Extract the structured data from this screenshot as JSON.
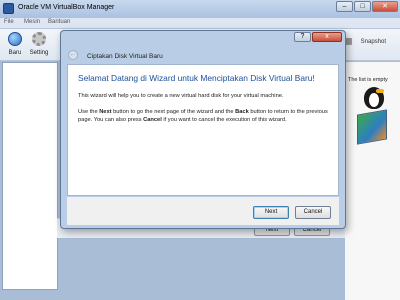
{
  "manager": {
    "title": "Oracle VM VirtualBox Manager",
    "menu": [
      "File",
      "Mesin",
      "Bantuan"
    ],
    "toolbar": {
      "new_label": "Baru",
      "settings_label": "Setting",
      "snapshot_label": "Snapshot"
    },
    "empty_list_text": "The list is empty",
    "behind_buttons": {
      "next": "Next",
      "cancel": "Cancel"
    }
  },
  "dialog": {
    "title": "Ciptakan Disk Virtual Baru",
    "heading": "Selamat Datang di Wizard untuk Menciptakan Disk Virtual Baru!",
    "paragraph1": "This wizard will help you to create a new virtual hard disk for your virtual machine.",
    "paragraph2_parts": {
      "a": "Use the ",
      "next": "Next",
      "b": " button to go the next page of the wizard and the ",
      "back": "Back",
      "c": " button to return to the previous page. You can also press ",
      "cancel": "Cancel",
      "d": " if you want to cancel the execution of this wizard."
    },
    "buttons": {
      "next": "Next",
      "cancel": "Cancel"
    },
    "help_glyph": "?",
    "close_glyph": "x"
  },
  "colors": {
    "heading": "#1a4f9c",
    "titlebar": "#b9cde6",
    "close": "#c8503a"
  },
  "icons": [
    "virtualbox-icon",
    "new-vm-icon",
    "gear-icon",
    "snapshot-icon",
    "help-icon",
    "close-icon",
    "back-arrow-icon",
    "penguin-icon",
    "cube-icon"
  ]
}
